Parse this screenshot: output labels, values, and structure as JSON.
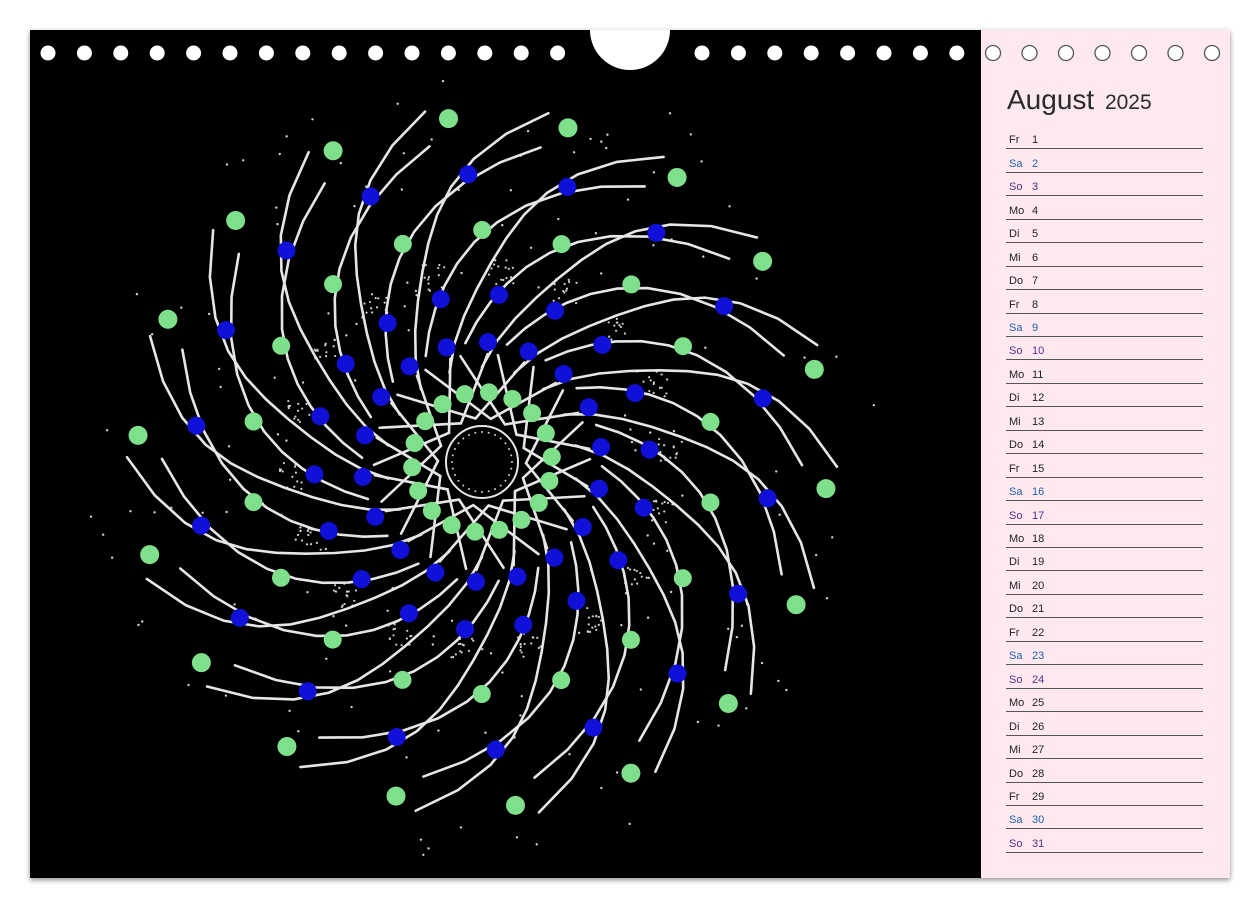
{
  "calendar": {
    "month": "August",
    "year": "2025",
    "days": [
      {
        "wd": "Fr",
        "d": "1",
        "type": "weekday"
      },
      {
        "wd": "Sa",
        "d": "2",
        "type": "sat"
      },
      {
        "wd": "So",
        "d": "3",
        "type": "sun"
      },
      {
        "wd": "Mo",
        "d": "4",
        "type": "weekday"
      },
      {
        "wd": "Di",
        "d": "5",
        "type": "weekday"
      },
      {
        "wd": "Mi",
        "d": "6",
        "type": "weekday"
      },
      {
        "wd": "Do",
        "d": "7",
        "type": "weekday"
      },
      {
        "wd": "Fr",
        "d": "8",
        "type": "weekday"
      },
      {
        "wd": "Sa",
        "d": "9",
        "type": "sat"
      },
      {
        "wd": "So",
        "d": "10",
        "type": "sun"
      },
      {
        "wd": "Mo",
        "d": "11",
        "type": "weekday"
      },
      {
        "wd": "Di",
        "d": "12",
        "type": "weekday"
      },
      {
        "wd": "Mi",
        "d": "13",
        "type": "weekday"
      },
      {
        "wd": "Do",
        "d": "14",
        "type": "weekday"
      },
      {
        "wd": "Fr",
        "d": "15",
        "type": "weekday"
      },
      {
        "wd": "Sa",
        "d": "16",
        "type": "sat"
      },
      {
        "wd": "So",
        "d": "17",
        "type": "sun"
      },
      {
        "wd": "Mo",
        "d": "18",
        "type": "weekday"
      },
      {
        "wd": "Di",
        "d": "19",
        "type": "weekday"
      },
      {
        "wd": "Mi",
        "d": "20",
        "type": "weekday"
      },
      {
        "wd": "Do",
        "d": "21",
        "type": "weekday"
      },
      {
        "wd": "Fr",
        "d": "22",
        "type": "weekday"
      },
      {
        "wd": "Sa",
        "d": "23",
        "type": "sat"
      },
      {
        "wd": "So",
        "d": "24",
        "type": "sun"
      },
      {
        "wd": "Mo",
        "d": "25",
        "type": "weekday"
      },
      {
        "wd": "Di",
        "d": "26",
        "type": "weekday"
      },
      {
        "wd": "Mi",
        "d": "27",
        "type": "weekday"
      },
      {
        "wd": "Do",
        "d": "28",
        "type": "weekday"
      },
      {
        "wd": "Fr",
        "d": "29",
        "type": "weekday"
      },
      {
        "wd": "Sa",
        "d": "30",
        "type": "sat"
      },
      {
        "wd": "So",
        "d": "31",
        "type": "sun"
      }
    ]
  },
  "artwork": {
    "icon": "mandala-artwork",
    "colors": {
      "background": "#000000",
      "strands": "#e6e6e6",
      "green_dots": "#7ee08a",
      "blue_dots": "#1010d8"
    }
  },
  "colors": {
    "sidebar_background": "#fde9ee",
    "saturday": "#1f5fb0",
    "sunday": "#5b2a8a"
  }
}
